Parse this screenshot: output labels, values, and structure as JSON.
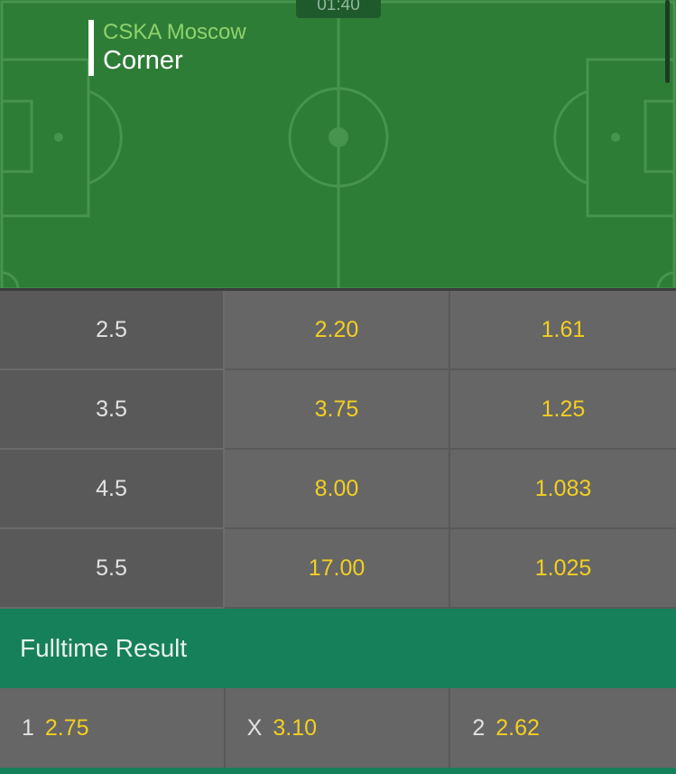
{
  "match": {
    "clock": "01:40",
    "event_team": "CSKA Moscow",
    "event_action": "Corner"
  },
  "colors": {
    "pitch": "#2e7d36",
    "pitch_lines": "#46944e",
    "odds_text": "#f2cf22",
    "accent_green": "#16805b"
  },
  "corners_market": {
    "rows": [
      {
        "line": "2.5",
        "over": "2.20",
        "under": "1.61"
      },
      {
        "line": "3.5",
        "over": "3.75",
        "under": "1.25"
      },
      {
        "line": "4.5",
        "over": "8.00",
        "under": "1.083"
      },
      {
        "line": "5.5",
        "over": "17.00",
        "under": "1.025"
      }
    ]
  },
  "fulltime_result": {
    "title": "Fulltime Result",
    "outcomes": [
      {
        "label": "1",
        "odds": "2.75"
      },
      {
        "label": "X",
        "odds": "3.10"
      },
      {
        "label": "2",
        "odds": "2.62"
      }
    ]
  }
}
